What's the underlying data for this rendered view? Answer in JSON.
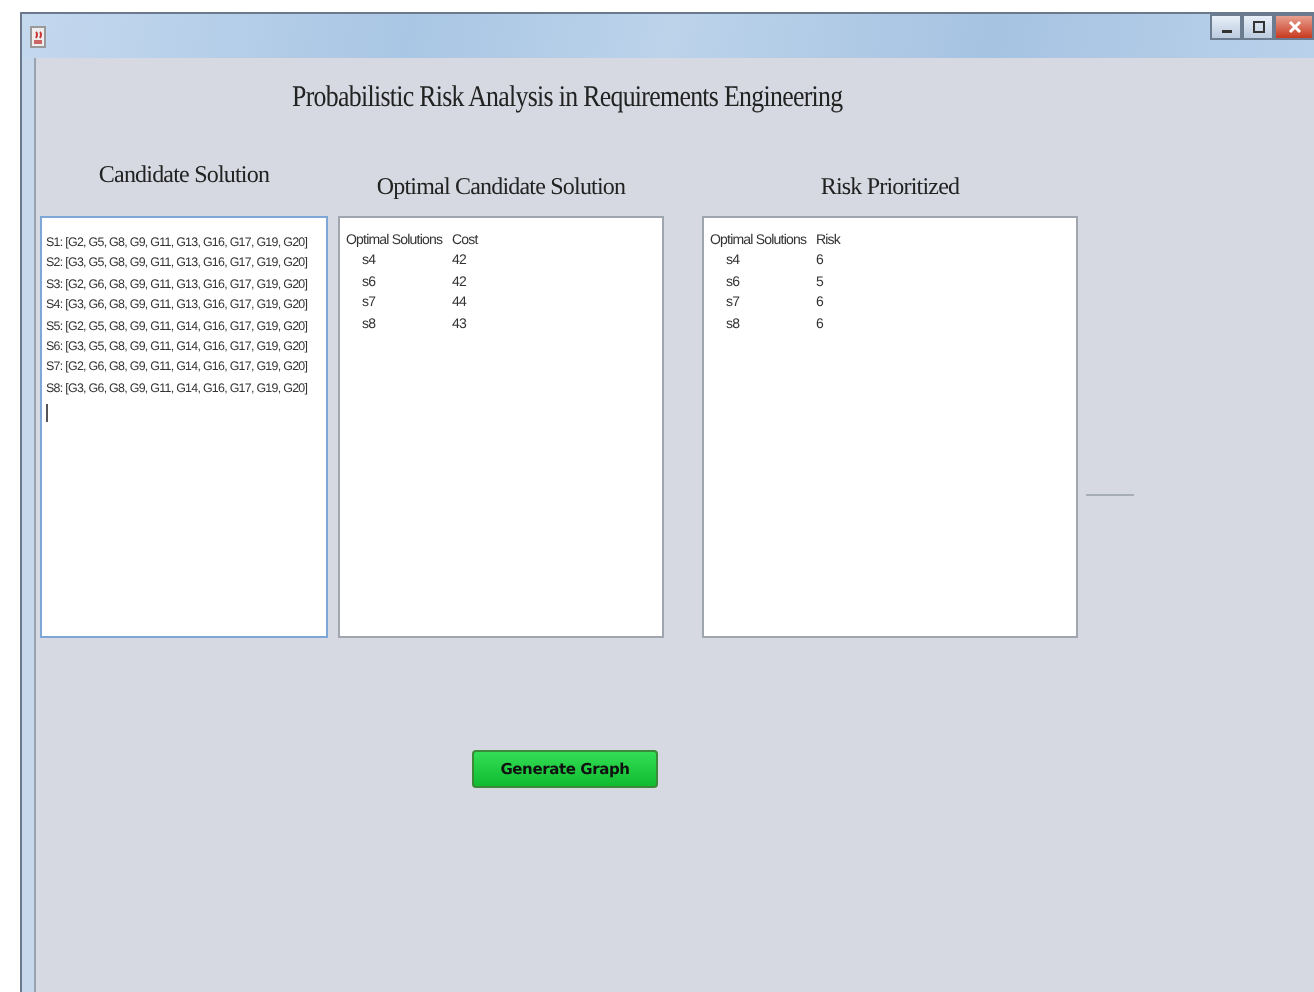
{
  "window": {
    "title": "Probabilistic Risk Analysis in Requirements Engineering"
  },
  "candidate": {
    "heading": "Candidate Solution",
    "lines": [
      "S1: [G2, G5, G8, G9, G11, G13, G16, G17, G19, G20]",
      "S2: [G3, G5, G8, G9, G11, G13, G16, G17, G19, G20]",
      "S3: [G2, G6, G8, G9, G11, G13, G16, G17, G19, G20]",
      "S4: [G3, G6, G8, G9, G11, G13, G16, G17, G19, G20]",
      "S5: [G2, G5, G8, G9, G11, G14, G16, G17, G19, G20]",
      "S6: [G3, G5, G8, G9, G11, G14, G16, G17, G19, G20]",
      "S7: [G2, G6, G8, G9, G11, G14, G16, G17, G19, G20]",
      "S8: [G3, G6, G8, G9, G11, G14, G16, G17, G19, G20]"
    ]
  },
  "optimal": {
    "heading": "Optimal Candidate Solution",
    "columns": [
      "Optimal Solutions",
      "Cost"
    ],
    "rows": [
      [
        "s4",
        "42"
      ],
      [
        "s6",
        "42"
      ],
      [
        "s7",
        "44"
      ],
      [
        "s8",
        "43"
      ]
    ]
  },
  "risk": {
    "heading": "Risk Prioritized",
    "columns": [
      "Optimal Solutions",
      "Risk"
    ],
    "rows": [
      [
        "s4",
        "6"
      ],
      [
        "s6",
        "5"
      ],
      [
        "s7",
        "6"
      ],
      [
        "s8",
        "6"
      ]
    ]
  },
  "button": "Generate Graph"
}
